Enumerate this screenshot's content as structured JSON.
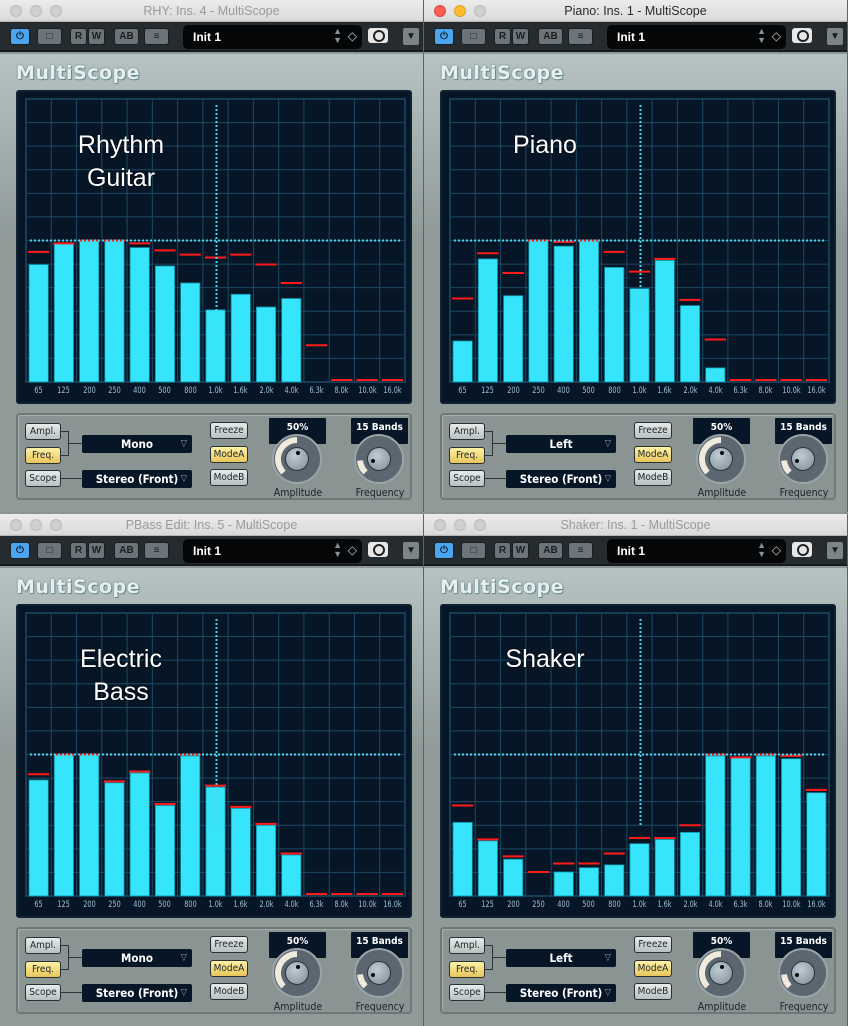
{
  "frequency_bands": [
    "65",
    "125",
    "200",
    "250",
    "400",
    "500",
    "800",
    "1.0k",
    "1.6k",
    "2.0k",
    "4.0k",
    "6.3k",
    "8.0k",
    "10.0k",
    "16.0k"
  ],
  "colors": {
    "bar": "#36e5fb",
    "peak": "#ff1a1a",
    "grid": "#1b4a63",
    "reference_line": "#4fd3e8",
    "screen_bg": "#071627",
    "active_button": "#f0d577",
    "power_button": "#4aa5ee"
  },
  "windows": [
    {
      "title": "RHY: Ins. 4 - MultiScope",
      "active": false,
      "toolbar": {
        "preset": "Init 1",
        "power": "⏻",
        "compare": "□",
        "read": "R",
        "write": "W",
        "ab": "AB",
        "menu": "≡",
        "dropdown": "▼",
        "preset_arrows": "⌃\n⌄",
        "diamond": "◇"
      },
      "logo": "MultiScope",
      "instrument_label": "Rhythm\nGuitar",
      "controls": {
        "ampl": "Ampl.",
        "freq": "Freq.",
        "scope": "Scope",
        "channel_select": "Mono",
        "mode_select": "Stereo (Front)",
        "freeze": "Freeze",
        "mode_a": "ModeA",
        "mode_b": "ModeB",
        "amplitude_display": "50%",
        "frequency_display": "15 Bands",
        "amplitude_label": "Amplitude",
        "frequency_label": "Frequency",
        "amplitude_value": 0.5,
        "frequency_value": 0.15
      }
    },
    {
      "title": "Piano: Ins. 1 - MultiScope",
      "active": true,
      "toolbar": {
        "preset": "Init 1",
        "power": "⏻",
        "compare": "□",
        "read": "R",
        "write": "W",
        "ab": "AB",
        "menu": "≡",
        "dropdown": "▼",
        "preset_arrows": "⌃\n⌄",
        "diamond": "◇"
      },
      "logo": "MultiScope",
      "instrument_label": "Piano",
      "controls": {
        "ampl": "Ampl.",
        "freq": "Freq.",
        "scope": "Scope",
        "channel_select": "Left",
        "mode_select": "Stereo (Front)",
        "freeze": "Freeze",
        "mode_a": "ModeA",
        "mode_b": "ModeB",
        "amplitude_display": "50%",
        "frequency_display": "15 Bands",
        "amplitude_label": "Amplitude",
        "frequency_label": "Frequency",
        "amplitude_value": 0.5,
        "frequency_value": 0.15
      }
    },
    {
      "title": "PBass Edit: Ins. 5 - MultiScope",
      "active": false,
      "toolbar": {
        "preset": "Init 1",
        "power": "⏻",
        "compare": "□",
        "read": "R",
        "write": "W",
        "ab": "AB",
        "menu": "≡",
        "dropdown": "▼",
        "preset_arrows": "⌃\n⌄",
        "diamond": "◇"
      },
      "logo": "MultiScope",
      "instrument_label": "Electric\nBass",
      "controls": {
        "ampl": "Ampl.",
        "freq": "Freq.",
        "scope": "Scope",
        "channel_select": "Mono",
        "mode_select": "Stereo (Front)",
        "freeze": "Freeze",
        "mode_a": "ModeA",
        "mode_b": "ModeB",
        "amplitude_display": "50%",
        "frequency_display": "15 Bands",
        "amplitude_label": "Amplitude",
        "frequency_label": "Frequency",
        "amplitude_value": 0.5,
        "frequency_value": 0.15
      }
    },
    {
      "title": "Shaker: Ins. 1 - MultiScope",
      "active": false,
      "toolbar": {
        "preset": "Init 1",
        "power": "⏻",
        "compare": "□",
        "read": "R",
        "write": "W",
        "ab": "AB",
        "menu": "≡",
        "dropdown": "▼",
        "preset_arrows": "⌃\n⌄",
        "diamond": "◇"
      },
      "logo": "MultiScope",
      "instrument_label": "Shaker",
      "controls": {
        "ampl": "Ampl.",
        "freq": "Freq.",
        "scope": "Scope",
        "channel_select": "Left",
        "mode_select": "Stereo (Front)",
        "freeze": "Freeze",
        "mode_a": "ModeA",
        "mode_b": "ModeB",
        "amplitude_display": "50%",
        "frequency_display": "15 Bands",
        "amplitude_label": "Amplitude",
        "frequency_label": "Frequency",
        "amplitude_value": 0.5,
        "frequency_value": 0.15
      }
    }
  ],
  "chart_data": [
    {
      "type": "bar",
      "title": "Rhythm Guitar",
      "categories": [
        "65",
        "125",
        "200",
        "250",
        "400",
        "500",
        "800",
        "1.0k",
        "1.6k",
        "2.0k",
        "4.0k",
        "6.3k",
        "8.0k",
        "10.0k",
        "16.0k"
      ],
      "series": [
        {
          "name": "level",
          "values": [
            0.415,
            0.49,
            0.5,
            0.5,
            0.475,
            0.41,
            0.35,
            0.255,
            0.31,
            0.265,
            0.295,
            0,
            0,
            0,
            0
          ]
        },
        {
          "name": "peak",
          "values": [
            0.46,
            0.49,
            0.5,
            0.5,
            0.49,
            0.465,
            0.45,
            0.44,
            0.45,
            0.415,
            0.35,
            0.13,
            0,
            0,
            0
          ]
        }
      ],
      "reference_level": 0.5,
      "ylim": [
        0,
        1
      ],
      "grid": true,
      "xlabel": "",
      "ylabel": ""
    },
    {
      "type": "bar",
      "title": "Piano",
      "categories": [
        "65",
        "125",
        "200",
        "250",
        "400",
        "500",
        "800",
        "1.0k",
        "1.6k",
        "2.0k",
        "4.0k",
        "6.3k",
        "8.0k",
        "10.0k",
        "16.0k"
      ],
      "series": [
        {
          "name": "level",
          "values": [
            0.145,
            0.435,
            0.305,
            0.5,
            0.48,
            0.5,
            0.405,
            0.33,
            0.43,
            0.27,
            0.05,
            0,
            0,
            0,
            0
          ]
        },
        {
          "name": "peak",
          "values": [
            0.295,
            0.455,
            0.385,
            0.5,
            0.495,
            0.5,
            0.46,
            0.39,
            0.435,
            0.29,
            0.15,
            0,
            0,
            0,
            0
          ]
        }
      ],
      "reference_level": 0.5,
      "ylim": [
        0,
        1
      ],
      "grid": true,
      "xlabel": "",
      "ylabel": ""
    },
    {
      "type": "bar",
      "title": "Electric Bass",
      "categories": [
        "65",
        "125",
        "200",
        "250",
        "400",
        "500",
        "800",
        "1.0k",
        "1.6k",
        "2.0k",
        "4.0k",
        "6.3k",
        "8.0k",
        "10.0k",
        "16.0k"
      ],
      "series": [
        {
          "name": "level",
          "values": [
            0.41,
            0.5,
            0.5,
            0.4,
            0.435,
            0.32,
            0.495,
            0.385,
            0.31,
            0.25,
            0.145,
            0,
            0,
            0,
            0
          ]
        },
        {
          "name": "peak",
          "values": [
            0.43,
            0.5,
            0.5,
            0.405,
            0.44,
            0.325,
            0.5,
            0.39,
            0.315,
            0.255,
            0.15,
            0,
            0,
            0,
            0
          ]
        }
      ],
      "reference_level": 0.5,
      "ylim": [
        0,
        1
      ],
      "grid": true,
      "xlabel": "",
      "ylabel": ""
    },
    {
      "type": "bar",
      "title": "Shaker",
      "categories": [
        "65",
        "125",
        "200",
        "250",
        "400",
        "500",
        "800",
        "1.0k",
        "1.6k",
        "2.0k",
        "4.0k",
        "6.3k",
        "8.0k",
        "10.0k",
        "16.0k"
      ],
      "series": [
        {
          "name": "level",
          "values": [
            0.26,
            0.195,
            0.13,
            0,
            0.085,
            0.1,
            0.11,
            0.185,
            0.2,
            0.225,
            0.495,
            0.49,
            0.495,
            0.485,
            0.365
          ]
        },
        {
          "name": "peak",
          "values": [
            0.32,
            0.2,
            0.14,
            0.085,
            0.115,
            0.115,
            0.15,
            0.205,
            0.205,
            0.25,
            0.5,
            0.49,
            0.5,
            0.495,
            0.375
          ]
        }
      ],
      "reference_level": 0.5,
      "ylim": [
        0,
        1
      ],
      "grid": true,
      "xlabel": "",
      "ylabel": ""
    }
  ]
}
